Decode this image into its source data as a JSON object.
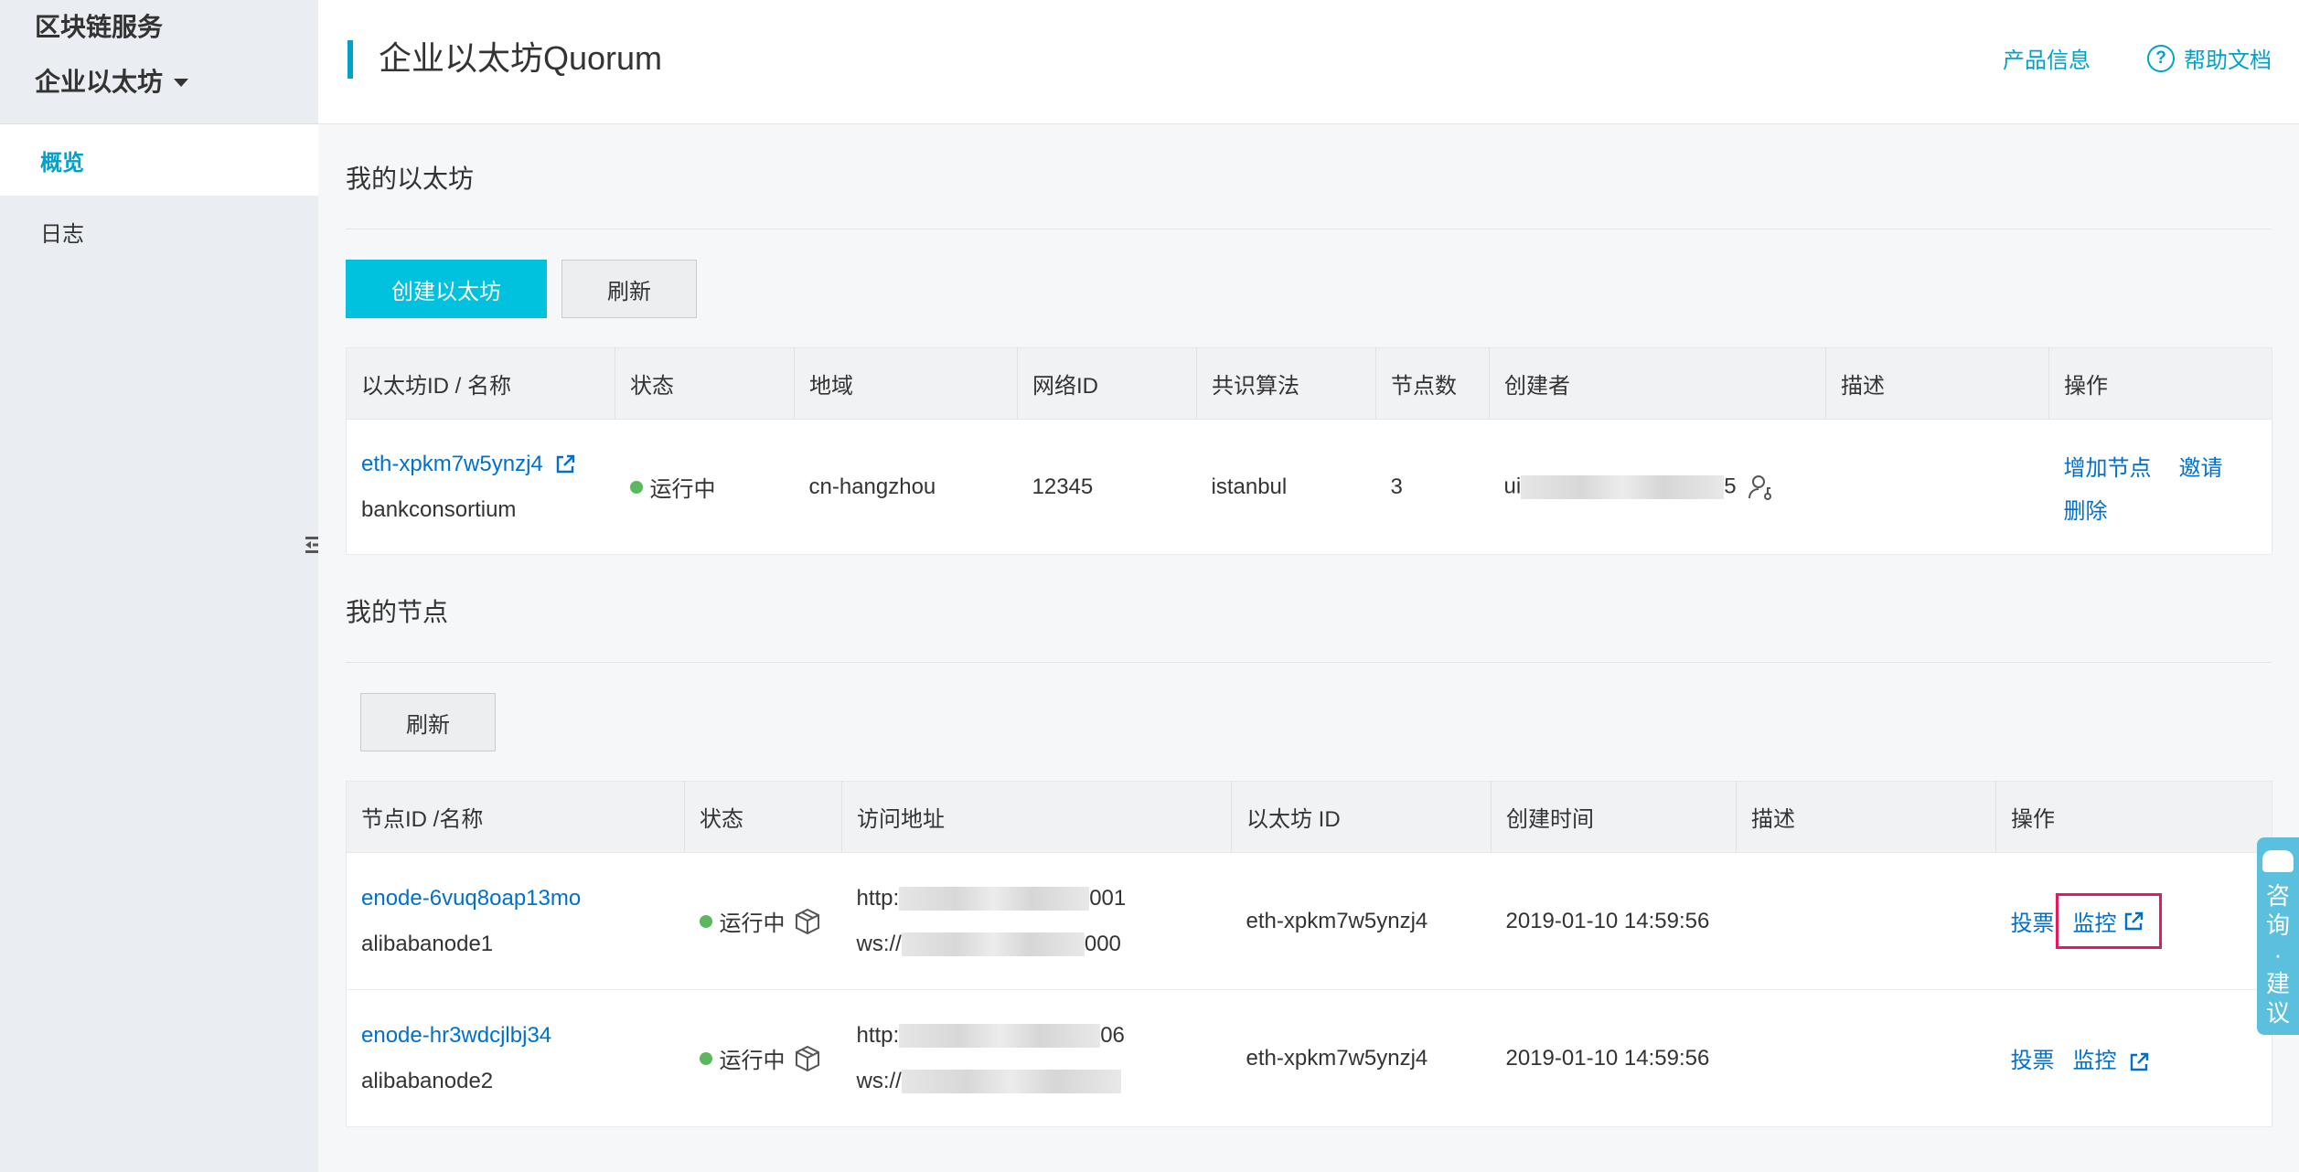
{
  "sidebar": {
    "service": "区块链服务",
    "product": "企业以太坊",
    "items": [
      {
        "label": "概览",
        "active": true
      },
      {
        "label": "日志",
        "active": false
      }
    ]
  },
  "header": {
    "title": "企业以太坊Quorum",
    "links": {
      "product_info": "产品信息",
      "help_docs": "帮助文档",
      "help_icon_glyph": "?"
    }
  },
  "ethereum_section": {
    "title": "我的以太坊",
    "create_button": "创建以太坊",
    "refresh_button": "刷新",
    "columns": [
      "以太坊ID / 名称",
      "状态",
      "地域",
      "网络ID",
      "共识算法",
      "节点数",
      "创建者",
      "描述",
      "操作"
    ],
    "rows": [
      {
        "id": "eth-xpkm7w5ynzj4",
        "name": "bankconsortium",
        "status": "运行中",
        "region": "cn-hangzhou",
        "network_id": "12345",
        "consensus": "istanbul",
        "nodes": "3",
        "creator_prefix": "ui",
        "creator_suffix": "5",
        "description": "",
        "ops": [
          "增加节点",
          "邀请",
          "删除"
        ]
      }
    ]
  },
  "nodes_section": {
    "title": "我的节点",
    "refresh_button": "刷新",
    "columns": [
      "节点ID /名称",
      "状态",
      "访问地址",
      "以太坊 ID",
      "创建时间",
      "描述",
      "操作"
    ],
    "rows": [
      {
        "id": "enode-6vuq8oap13mo",
        "name": "alibabanode1",
        "status": "运行中",
        "http_prefix": "http:",
        "http_suffix": "001",
        "ws_prefix": "ws://",
        "ws_suffix": "000",
        "eth_id": "eth-xpkm7w5ynzj4",
        "created": "2019-01-10 14:59:56",
        "description": "",
        "vote": "投票",
        "monitor": "监控"
      },
      {
        "id": "enode-hr3wdcjlbj34",
        "name": "alibabanode2",
        "status": "运行中",
        "http_prefix": "http:",
        "http_suffix": "06",
        "ws_prefix": "ws://",
        "ws_suffix": "",
        "eth_id": "eth-xpkm7w5ynzj4",
        "created": "2019-01-10 14:59:56",
        "description": "",
        "vote": "投票",
        "monitor": "监控"
      }
    ]
  },
  "feedback": {
    "chars": [
      "咨",
      "询",
      "·",
      "建",
      "议"
    ]
  },
  "colors": {
    "accent": "#00a2ca",
    "primary_button": "#00c1de",
    "link": "#0070cc",
    "running": "#5cb85c",
    "highlight": "#e8195a"
  }
}
